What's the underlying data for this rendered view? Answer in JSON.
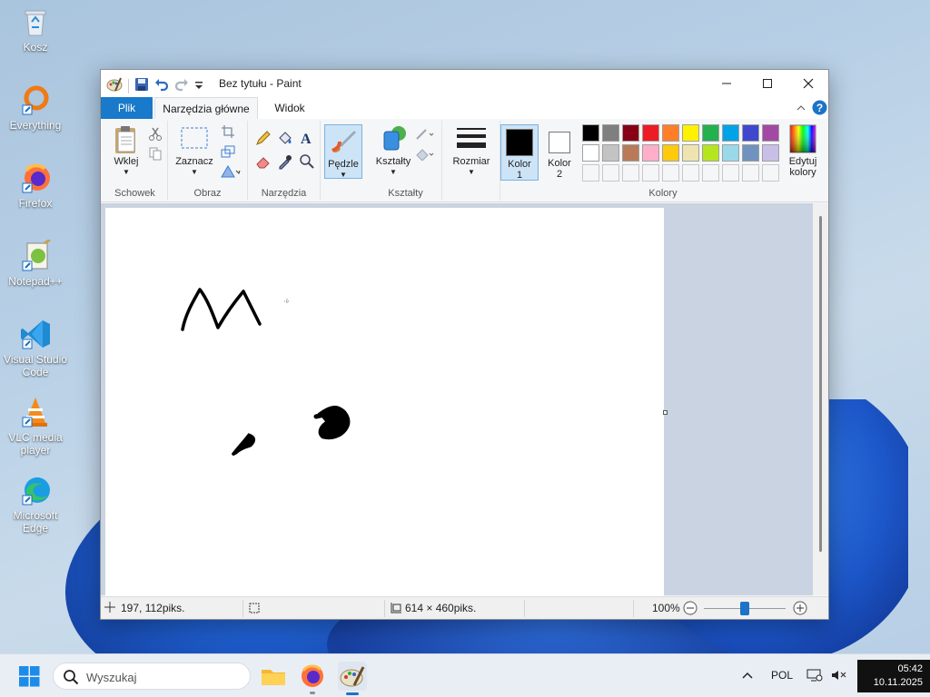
{
  "desktop": {
    "icons": [
      {
        "label": "Kosz",
        "icon": "recycle-bin-icon"
      },
      {
        "label": "Everything",
        "icon": "everything-icon"
      },
      {
        "label": "Firefox",
        "icon": "firefox-icon"
      },
      {
        "label": "Notepad++",
        "icon": "notepad-plus-plus-icon"
      },
      {
        "label": "Visual Studio Code",
        "icon": "vscode-icon"
      },
      {
        "label": "VLC media player",
        "icon": "vlc-icon"
      },
      {
        "label": "Microsoft Edge",
        "icon": "edge-icon"
      }
    ]
  },
  "window": {
    "title": "Bez tytułu - Paint",
    "tabs": {
      "file": "Plik",
      "home": "Narzędzia główne",
      "view": "Widok"
    },
    "ribbon": {
      "clipboard": {
        "label": "Schowek",
        "paste": "Wklej"
      },
      "image": {
        "label": "Obraz",
        "select": "Zaznacz"
      },
      "tools": {
        "label": "Narzędzia"
      },
      "brushes": {
        "label": "Pędzle"
      },
      "shapes": {
        "label": "Kształty",
        "shapes_btn": "Kształty"
      },
      "size": {
        "label": "Rozmiar"
      },
      "colors": {
        "label": "Kolory",
        "color1": "Kolor 1",
        "color2": "Kolor 2",
        "edit": "Edytuj kolory",
        "color1_value": "#000000",
        "color2_value": "#ffffff",
        "palette_row1": [
          "#000000",
          "#7f7f7f",
          "#880015",
          "#ed1c24",
          "#ff7f27",
          "#fff200",
          "#22b14c",
          "#00a2e8",
          "#3f48cc",
          "#a349a4"
        ],
        "palette_row2": [
          "#ffffff",
          "#c3c3c3",
          "#b97a57",
          "#ffaec9",
          "#ffc90e",
          "#efe4b0",
          "#b5e61d",
          "#99d9ea",
          "#7092be",
          "#c8bfe7"
        ]
      }
    },
    "status": {
      "cursor": "197, 112piks.",
      "size": "614 × 460piks.",
      "zoom": "100%"
    }
  },
  "taskbar": {
    "search_placeholder": "Wyszukaj",
    "language": "POL",
    "time": "05:42",
    "date": "10.11.2025"
  }
}
